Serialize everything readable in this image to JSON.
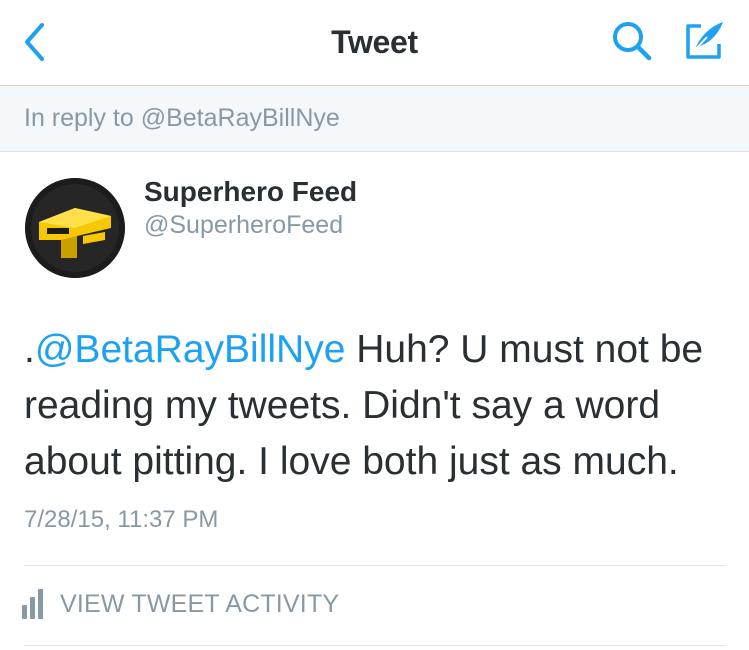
{
  "nav": {
    "title": "Tweet",
    "back_icon": "chevron-left-icon",
    "search_icon": "search-icon",
    "compose_icon": "compose-icon",
    "icon_color": "#1da1f2"
  },
  "reply_context": {
    "text": "In reply to @BetaRayBillNye"
  },
  "author": {
    "name": "Superhero Feed",
    "handle": "@SuperheroFeed",
    "avatar_icon": "superhero-feed-logo",
    "avatar_colors": {
      "background": "#1c1c1c",
      "logo": "#f7c800"
    }
  },
  "tweet": {
    "prefix": ".",
    "mention": "@BetaRayBillNye",
    "body": " Huh? U must not be reading my tweets. Didn't say a word about pitting. I love both just as much.",
    "timestamp": "7/28/15, 11:37 PM",
    "mention_color": "#1da1f2"
  },
  "activity": {
    "label": "VIEW TWEET ACTIVITY",
    "icon": "bar-chart-icon"
  }
}
